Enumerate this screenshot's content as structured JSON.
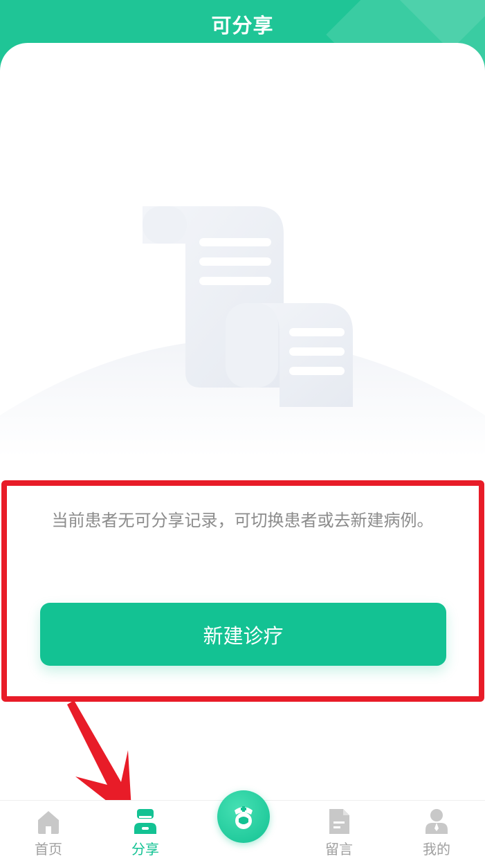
{
  "header": {
    "title": "可分享"
  },
  "empty_state": {
    "message": "当前患者无可分享记录，可切换患者或去新建病例。",
    "action_label": "新建诊疗"
  },
  "tabbar": {
    "items": [
      {
        "label": "首页",
        "icon": "home-icon",
        "active": false
      },
      {
        "label": "分享",
        "icon": "share-doctor-icon",
        "active": true
      },
      {
        "label": "",
        "icon": "center-doctor-icon",
        "active": false
      },
      {
        "label": "留言",
        "icon": "document-icon",
        "active": false
      },
      {
        "label": "我的",
        "icon": "user-icon",
        "active": false
      }
    ]
  },
  "colors": {
    "brand": "#1fc596",
    "button": "#13c293",
    "highlight": "#e81c28",
    "inactive": "#a0a0a0"
  }
}
